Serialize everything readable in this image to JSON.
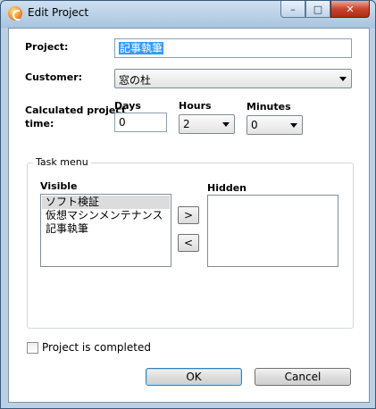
{
  "window": {
    "title": "Edit Project",
    "icon": "app-logo-icon"
  },
  "caption": {
    "minimize": "–",
    "maximize": "□",
    "close": "✕"
  },
  "form": {
    "project_label": "Project:",
    "project_value": "記事執筆",
    "customer_label": "Customer:",
    "customer_value": "窓の杜",
    "calc_label_line1": "Calculated project",
    "calc_label_line2": "time:",
    "days_label": "Days",
    "days_value": "0",
    "hours_label": "Hours",
    "hours_value": "2",
    "minutes_label": "Minutes",
    "minutes_value": "0"
  },
  "task_menu": {
    "title": "Task menu",
    "visible_label": "Visible",
    "hidden_label": "Hidden",
    "visible_items": [
      "ソフト検証",
      "仮想マシンメンテナンス",
      "記事執筆"
    ],
    "hidden_items": [],
    "move_right": ">",
    "move_left": "<"
  },
  "completed_label": "Project is completed",
  "buttons": {
    "ok": "OK",
    "cancel": "Cancel"
  }
}
